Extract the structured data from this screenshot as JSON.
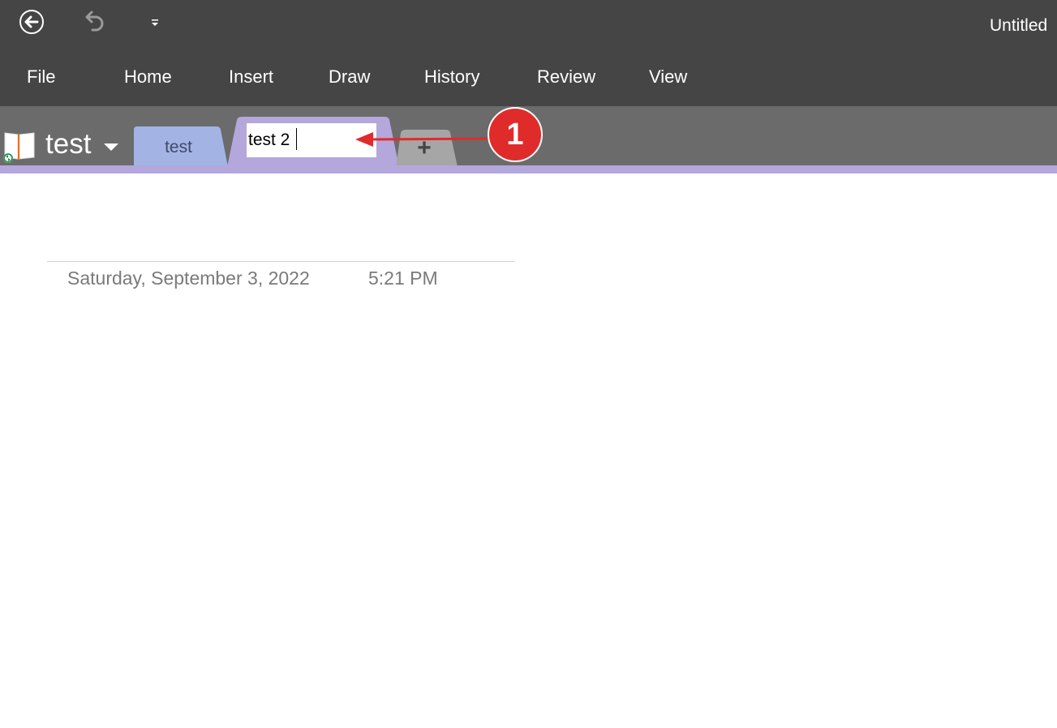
{
  "titlebar": {
    "title": "Untitled",
    "icons": [
      "back-arrow-icon",
      "undo-icon",
      "customize-dropdown-icon"
    ]
  },
  "ribbon": {
    "tabs": [
      {
        "label": "File"
      },
      {
        "label": "Home"
      },
      {
        "label": "Insert"
      },
      {
        "label": "Draw"
      },
      {
        "label": "History"
      },
      {
        "label": "Review"
      },
      {
        "label": "View"
      }
    ]
  },
  "notebook": {
    "name": "test",
    "icon": "notebook-icon",
    "sync_icon": "sync-icon"
  },
  "sections": {
    "tab1_label": "test",
    "active_tab_input_value": "test 2",
    "add_tab_label": "+"
  },
  "page": {
    "date": "Saturday, September 3, 2022",
    "time": "5:21 PM"
  },
  "annotation": {
    "number": "1",
    "color": "#e02b2b"
  },
  "colors": {
    "titlebar_bg": "#454545",
    "section_bar_bg": "#6b6b6b",
    "section_accent": "#b4a7dc",
    "tab1_color": "#a3b4e4",
    "add_tab_color": "#a6a6a6"
  }
}
